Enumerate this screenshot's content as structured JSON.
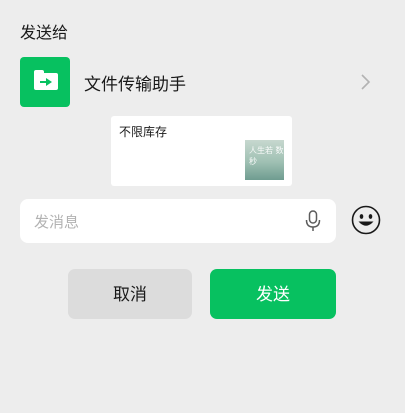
{
  "dialog": {
    "title": "发送给"
  },
  "recipient": {
    "name": "文件传输助手",
    "avatar_icon": "file-transfer-icon",
    "chevron_icon": "chevron-right-icon"
  },
  "preview": {
    "title": "不限库存",
    "thumbnail_text": "人生若 数秒"
  },
  "message_input": {
    "value": "",
    "placeholder": "发消息",
    "mic_icon": "microphone-icon"
  },
  "emoji_icon": "emoji-icon",
  "buttons": {
    "cancel_label": "取消",
    "send_label": "发送"
  },
  "colors": {
    "accent": "#07c160",
    "background": "#ededed",
    "cancel_bg": "#dcdcdc"
  }
}
